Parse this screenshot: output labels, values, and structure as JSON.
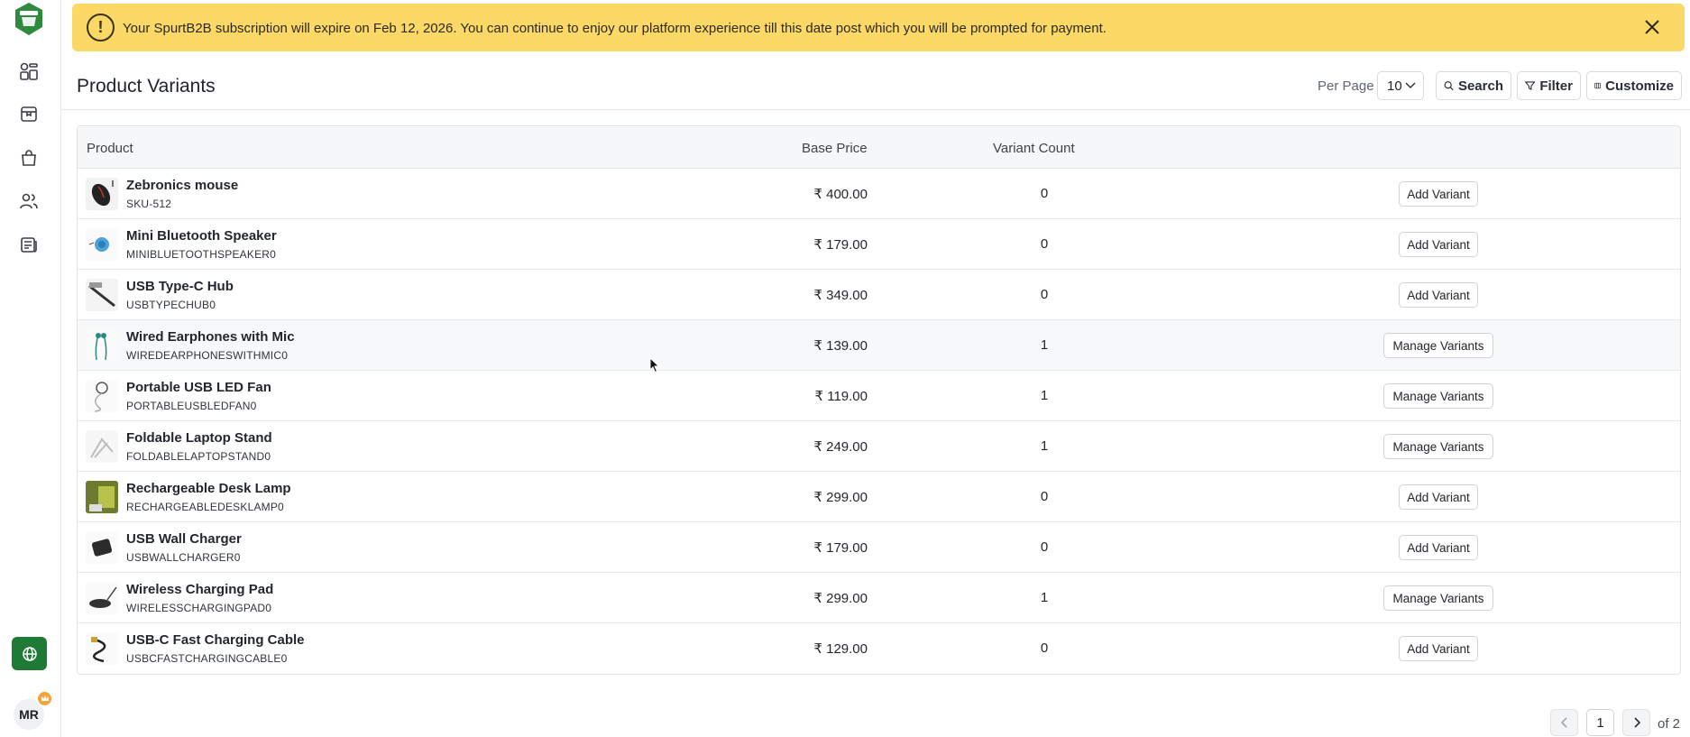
{
  "app": {
    "logo_text": "Spurt",
    "avatar_initials": "MR"
  },
  "banner": {
    "icon": "exclamation-icon",
    "text": "Your SpurtB2B subscription will expire on Feb 12, 2026. You can continue to enjoy our platform experience till this date post which you will be prompted for payment.",
    "bg_color": "#fcd866"
  },
  "header": {
    "title": "Product Variants",
    "per_page_label": "Per Page",
    "per_page_value": "10",
    "search_label": "Search",
    "filter_label": "Filter",
    "customize_label": "Customize"
  },
  "table": {
    "columns": {
      "product": "Product",
      "base_price": "Base Price",
      "variant_count": "Variant Count"
    },
    "rows": [
      {
        "name": "Zebronics mouse",
        "sku": "SKU-512",
        "price": "₹ 400.00",
        "count": "0",
        "action": "Add Variant"
      },
      {
        "name": "Mini Bluetooth Speaker",
        "sku": "MINIBLUETOOTHSPEAKER0",
        "price": "₹ 179.00",
        "count": "0",
        "action": "Add Variant"
      },
      {
        "name": "USB Type-C Hub",
        "sku": "USBTYPECHUB0",
        "price": "₹ 349.00",
        "count": "0",
        "action": "Add Variant"
      },
      {
        "name": "Wired Earphones with Mic",
        "sku": "WIREDEARPHONESWITHMIC0",
        "price": "₹ 139.00",
        "count": "1",
        "action": "Manage Variants"
      },
      {
        "name": "Portable USB LED Fan",
        "sku": "PORTABLEUSBLEDFAN0",
        "price": "₹ 119.00",
        "count": "1",
        "action": "Manage Variants"
      },
      {
        "name": "Foldable Laptop Stand",
        "sku": "FOLDABLELAPTOPSTAND0",
        "price": "₹ 249.00",
        "count": "1",
        "action": "Manage Variants"
      },
      {
        "name": "Rechargeable Desk Lamp",
        "sku": "RECHARGEABLEDESKLAMP0",
        "price": "₹ 299.00",
        "count": "0",
        "action": "Add Variant"
      },
      {
        "name": "USB Wall Charger",
        "sku": "USBWALLCHARGER0",
        "price": "₹ 179.00",
        "count": "0",
        "action": "Add Variant"
      },
      {
        "name": "Wireless Charging Pad",
        "sku": "WIRELESSCHARGINGPAD0",
        "price": "₹ 299.00",
        "count": "1",
        "action": "Manage Variants"
      },
      {
        "name": "USB-C Fast Charging Cable",
        "sku": "USBCFASTCHARGINGCABLE0",
        "price": "₹ 129.00",
        "count": "0",
        "action": "Add Variant"
      }
    ]
  },
  "pagination": {
    "current_page": "1",
    "of_label": "of 2"
  },
  "colors": {
    "brand_green": "#1e7a34",
    "badge_orange": "#f5a33b"
  }
}
